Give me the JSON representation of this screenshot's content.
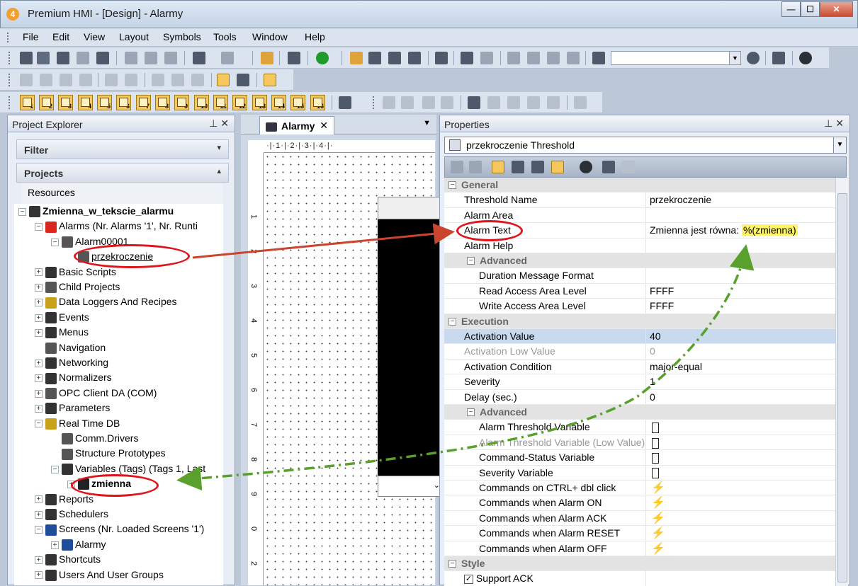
{
  "window": {
    "title": "Premium HMI - [Design] - Alarmy",
    "app_icon": "4",
    "min": "—",
    "max": "☐",
    "close": "✕"
  },
  "menu": [
    "File",
    "Edit",
    "View",
    "Layout",
    "Symbols",
    "Tools",
    "Window",
    "Help"
  ],
  "numbered_tools": [
    "1",
    "2",
    "3",
    "4",
    "5",
    "6",
    "7",
    "8",
    "9",
    "10",
    "11",
    "12",
    "13",
    "14",
    "15",
    "16"
  ],
  "project_explorer": {
    "title": "Project Explorer",
    "filter_label": "Filter",
    "projects_label": "Projects",
    "resources_label": "Resources",
    "tree": [
      {
        "label": "Zmienna_w_tekscie_alarmu",
        "level": 0,
        "exp": "⊟",
        "bold": true,
        "icon": "gear-icon"
      },
      {
        "label": "Alarms (Nr. Alarms '1', Nr. Runti",
        "level": 1,
        "exp": "⊟",
        "icon": "alarm-bell-icon"
      },
      {
        "label": "Alarm00001",
        "level": 2,
        "exp": "⊟",
        "icon": "alarm-item-icon"
      },
      {
        "label": "przekroczenie",
        "level": 3,
        "exp": "",
        "icon": "alarm-threshold-icon"
      },
      {
        "label": "Basic Scripts",
        "level": 1,
        "exp": "⊞",
        "icon": "script-icon"
      },
      {
        "label": "Child Projects",
        "level": 1,
        "exp": "⊞",
        "icon": "child-projects-icon"
      },
      {
        "label": "Data Loggers And Recipes",
        "level": 1,
        "exp": "⊞",
        "icon": "database-icon"
      },
      {
        "label": "Events",
        "level": 1,
        "exp": "⊞",
        "icon": "events-icon"
      },
      {
        "label": "Menus",
        "level": 1,
        "exp": "⊞",
        "icon": "menus-icon"
      },
      {
        "label": "Navigation",
        "level": 1,
        "exp": "",
        "icon": "navigation-icon"
      },
      {
        "label": "Networking",
        "level": 1,
        "exp": "⊞",
        "icon": "networking-icon"
      },
      {
        "label": "Normalizers",
        "level": 1,
        "exp": "⊞",
        "icon": "normalizers-icon"
      },
      {
        "label": "OPC Client DA (COM)",
        "level": 1,
        "exp": "⊞",
        "icon": "opc-client-icon"
      },
      {
        "label": "Parameters",
        "level": 1,
        "exp": "⊞",
        "icon": "parameters-icon"
      },
      {
        "label": "Real Time DB",
        "level": 1,
        "exp": "⊟",
        "icon": "realtime-db-icon"
      },
      {
        "label": "Comm.Drivers",
        "level": 2,
        "exp": "",
        "icon": "comm-drivers-icon"
      },
      {
        "label": "Structure Prototypes",
        "level": 2,
        "exp": "",
        "icon": "structure-prototypes-icon"
      },
      {
        "label": "Variables (Tags) (Tags 1, Last",
        "level": 2,
        "exp": "⊟",
        "icon": "variables-icon"
      },
      {
        "label": "zmienna",
        "level": 3,
        "exp": "⊞",
        "bold": true,
        "icon": "variable-tag-icon"
      },
      {
        "label": "Reports",
        "level": 1,
        "exp": "⊞",
        "icon": "reports-icon"
      },
      {
        "label": "Schedulers",
        "level": 1,
        "exp": "⊞",
        "icon": "schedulers-icon"
      },
      {
        "label": "Screens (Nr. Loaded Screens '1')",
        "level": 1,
        "exp": "⊟",
        "icon": "screens-icon"
      },
      {
        "label": "Alarmy",
        "level": 2,
        "exp": "⊞",
        "icon": "screen-icon"
      },
      {
        "label": "Shortcuts",
        "level": 1,
        "exp": "⊞",
        "icon": "shortcuts-icon"
      },
      {
        "label": "Users And User Groups",
        "level": 1,
        "exp": "⊞",
        "icon": "users-icon"
      }
    ]
  },
  "editor": {
    "tab_label": "Alarmy",
    "tab_close": "✕",
    "ruler_h": "·|·1·|·2·|·3·|·4·|·",
    "ruler_v": [
      "1",
      "2",
      "3",
      "4",
      "5",
      "6",
      "7",
      "8",
      "9",
      "0",
      "2"
    ]
  },
  "properties": {
    "title": "Properties",
    "selected": "przekroczenie Threshold",
    "rows": [
      {
        "type": "cat",
        "name": "General"
      },
      {
        "type": "row",
        "name": "Threshold Name",
        "value": "przekroczenie"
      },
      {
        "type": "row",
        "name": "Alarm Area",
        "value": ""
      },
      {
        "type": "row",
        "name": "Alarm Text",
        "value": "Zmienna jest równa: ",
        "highlight": "%(zmienna)"
      },
      {
        "type": "row",
        "name": "Alarm Help",
        "value": ""
      },
      {
        "type": "subcat",
        "name": "Advanced"
      },
      {
        "type": "sub",
        "name": "Duration Message Format",
        "value": ""
      },
      {
        "type": "sub",
        "name": "Read Access Area Level",
        "value": "FFFF"
      },
      {
        "type": "sub",
        "name": "Write Access Area Level",
        "value": "FFFF"
      },
      {
        "type": "cat",
        "name": "Execution"
      },
      {
        "type": "row",
        "name": "Activation Value",
        "value": "40",
        "hl": true
      },
      {
        "type": "row",
        "name": "Activation Low Value",
        "value": "0",
        "dis": true
      },
      {
        "type": "row",
        "name": "Activation Condition",
        "value": "major-equal"
      },
      {
        "type": "row",
        "name": "Severity",
        "value": "1"
      },
      {
        "type": "row",
        "name": "Delay (sec.)",
        "value": "0"
      },
      {
        "type": "subcat",
        "name": "Advanced"
      },
      {
        "type": "sub",
        "name": "Alarm Threshold Variable",
        "value": "",
        "icon": "tag"
      },
      {
        "type": "sub",
        "name": "Alarm Threshold Variable (Low Value)",
        "value": "",
        "icon": "tag",
        "dis": true
      },
      {
        "type": "sub",
        "name": "Command-Status Variable",
        "value": "",
        "icon": "tag"
      },
      {
        "type": "sub",
        "name": "Severity Variable",
        "value": "",
        "icon": "tag"
      },
      {
        "type": "sub",
        "name": "Commands on CTRL+ dbl click",
        "value": "",
        "icon": "bolt"
      },
      {
        "type": "sub",
        "name": "Commands when Alarm ON",
        "value": "",
        "icon": "bolt"
      },
      {
        "type": "sub",
        "name": "Commands when Alarm ACK",
        "value": "",
        "icon": "bolt"
      },
      {
        "type": "sub",
        "name": "Commands when Alarm RESET",
        "value": "",
        "icon": "bolt"
      },
      {
        "type": "sub",
        "name": "Commands when Alarm OFF",
        "value": "",
        "icon": "bolt"
      },
      {
        "type": "cat",
        "name": "Style"
      },
      {
        "type": "row",
        "name": "Support ACK",
        "value": "",
        "check": true
      }
    ]
  },
  "colors": {
    "annotation_oval": "#e0151c",
    "arrow_red": "#c9452e",
    "arrow_green": "#5aa02c",
    "highlight": "#fff36a"
  }
}
